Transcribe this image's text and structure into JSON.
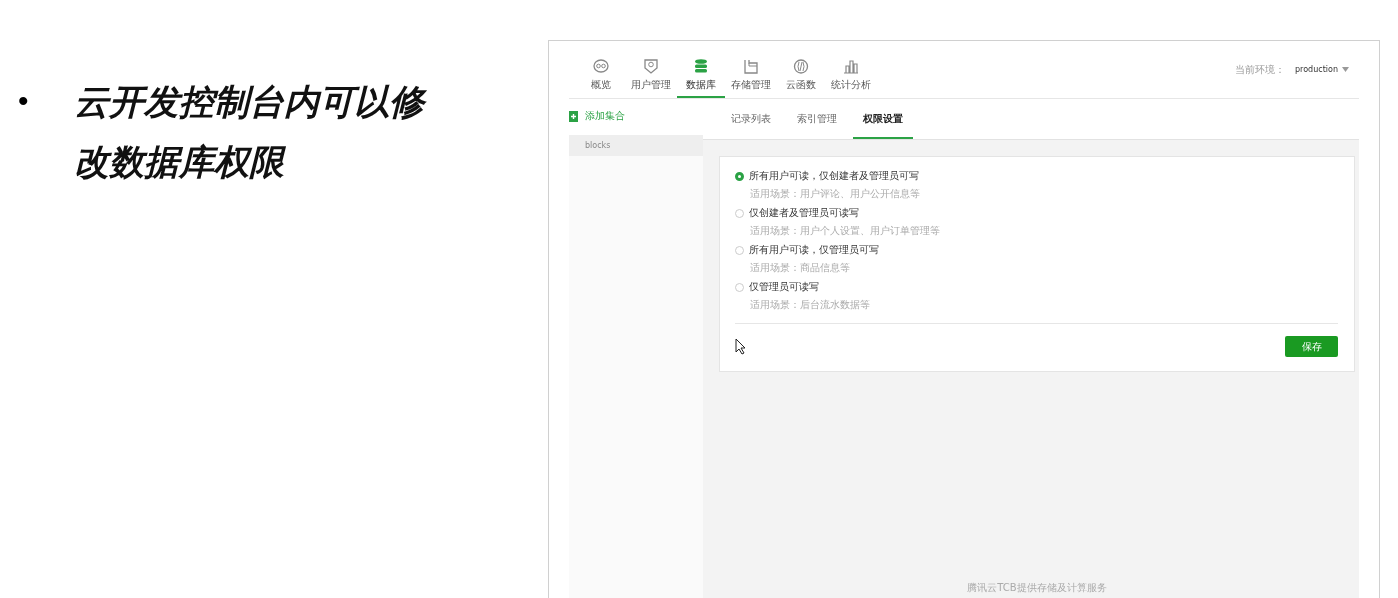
{
  "slide": {
    "bullet": "•",
    "title_lines": [
      "云开发控制台内可以修",
      "改数据库权限"
    ]
  },
  "console": {
    "nav": [
      {
        "label": "概览",
        "selected": false
      },
      {
        "label": "用户管理",
        "selected": false
      },
      {
        "label": "数据库",
        "selected": true
      },
      {
        "label": "存储管理",
        "selected": false
      },
      {
        "label": "云函数",
        "selected": false
      },
      {
        "label": "统计分析",
        "selected": false
      }
    ],
    "environment": {
      "label": "当前环境：",
      "value": "production"
    },
    "sidebar": {
      "add_button": "添加集合",
      "collections": [
        {
          "name": "blocks",
          "selected": true
        }
      ]
    },
    "tabs": [
      {
        "label": "记录列表",
        "selected": false
      },
      {
        "label": "索引管理",
        "selected": false
      },
      {
        "label": "权限设置",
        "selected": true
      }
    ],
    "permissions": [
      {
        "label": "所有用户可读，仅创建者及管理员可写",
        "hint": "适用场景：用户评论、用户公开信息等",
        "selected": true
      },
      {
        "label": "仅创建者及管理员可读写",
        "hint": "适用场景：用户个人设置、用户订单管理等",
        "selected": false
      },
      {
        "label": "所有用户可读，仅管理员可写",
        "hint": "适用场景：商品信息等",
        "selected": false
      },
      {
        "label": "仅管理员可读写",
        "hint": "适用场景：后台流水数据等",
        "selected": false
      }
    ],
    "save_button": "保存",
    "footer": "腾讯云TCB提供存储及计算服务"
  }
}
